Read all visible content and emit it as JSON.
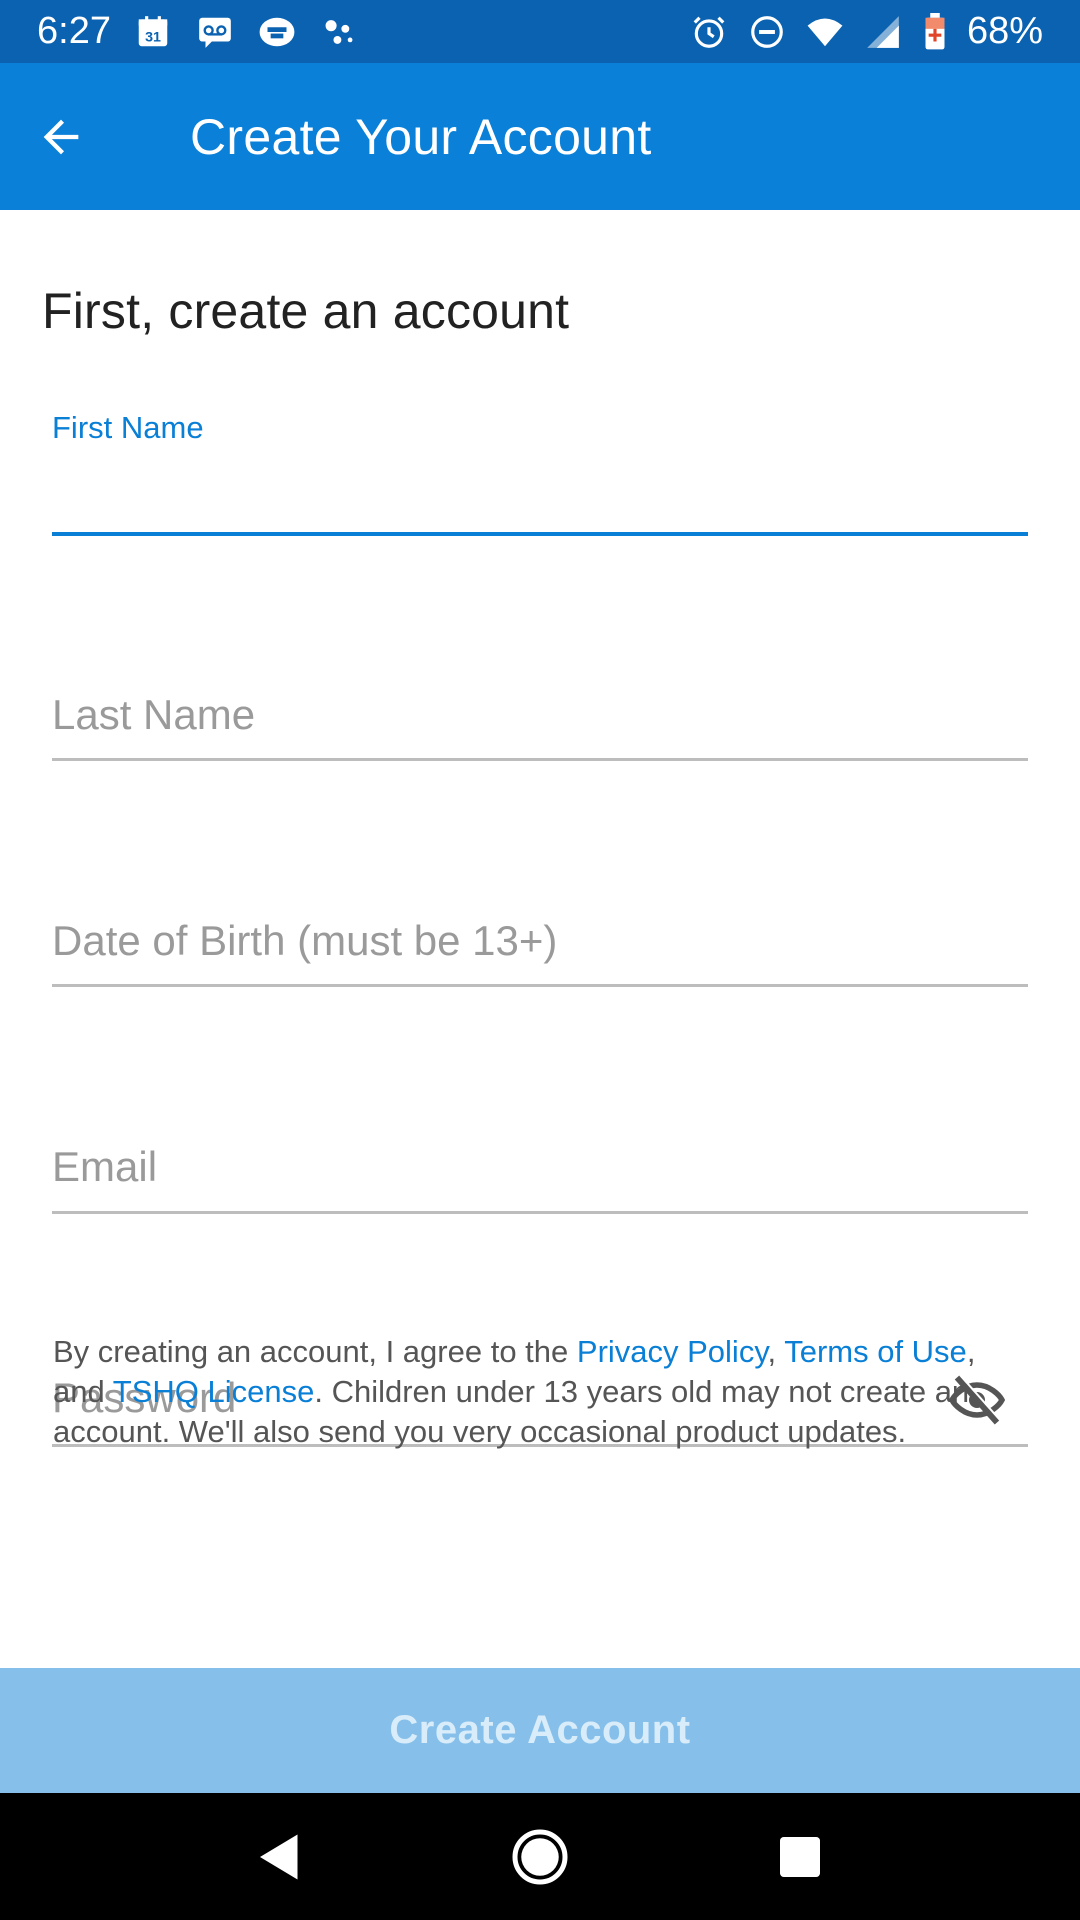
{
  "status_bar": {
    "time": "6:27",
    "calendar_day": "31",
    "battery_percent": "68%",
    "icons": [
      "calendar-icon",
      "voicemail-icon",
      "printer-icon",
      "dots-icon",
      "alarm-icon",
      "do-not-disturb-icon",
      "wifi-icon",
      "signal-icon",
      "battery-icon"
    ]
  },
  "app_bar": {
    "title": "Create Your Account",
    "back_icon": "arrow-left-icon"
  },
  "form": {
    "heading": "First, create an account",
    "first_name": {
      "label": "First Name",
      "value": ""
    },
    "last_name": {
      "placeholder": "Last Name",
      "value": ""
    },
    "dob": {
      "placeholder": "Date of Birth (must be 13+)",
      "value": ""
    },
    "email": {
      "placeholder": "Email",
      "value": ""
    },
    "password": {
      "placeholder": "Password",
      "value": "",
      "toggle_icon": "eye-off-icon"
    }
  },
  "terms": {
    "part1": "By creating an account, I agree to the ",
    "privacy_link": "Privacy Policy",
    "sep1": ", ",
    "terms_link": "Terms of Use",
    "sep2": ", and ",
    "license_link": "TSHQ License",
    "part2": ". Children under 13 years old may not create an account. We'll also send you very occasional product updates."
  },
  "cta": {
    "label": "Create Account"
  },
  "nav_bar": {
    "icons": [
      "back-triangle-icon",
      "home-circle-icon",
      "recents-square-icon"
    ]
  },
  "colors": {
    "status_bar": "#0a62b1",
    "app_bar": "#0a80d8",
    "accent": "#0a7fd6",
    "cta_disabled": "#86c0ea"
  }
}
